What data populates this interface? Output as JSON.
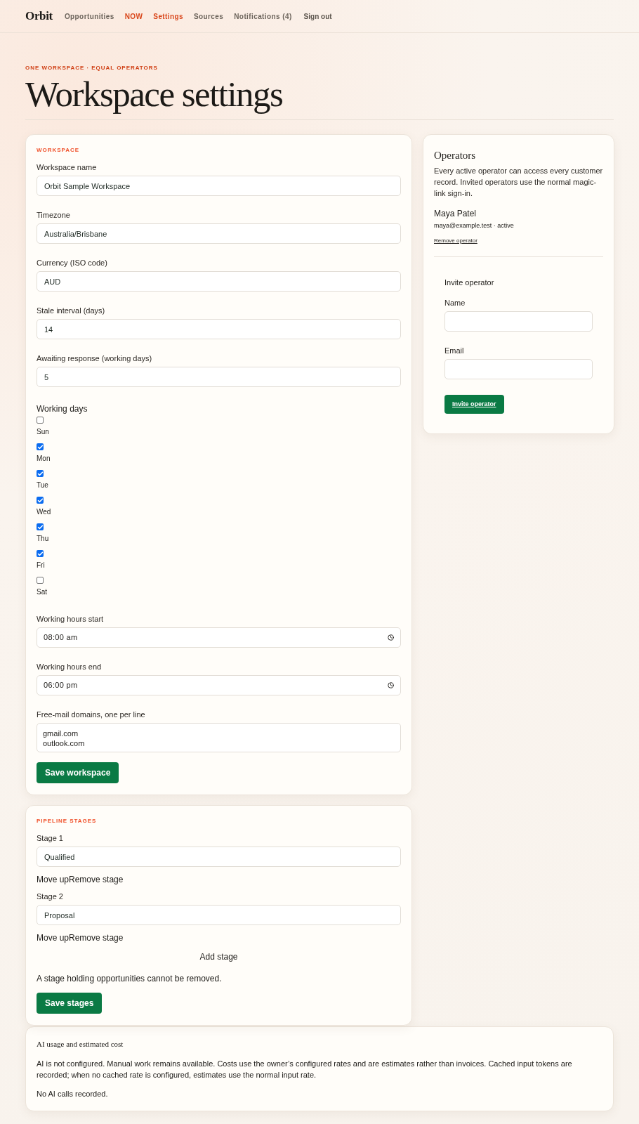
{
  "nav": {
    "logo": "Orbit",
    "items": [
      {
        "label": "Opportunities",
        "accent": false
      },
      {
        "label": "NOW",
        "accent": true
      },
      {
        "label": "Settings",
        "accent": true
      },
      {
        "label": "Sources",
        "accent": false
      },
      {
        "label": "Notifications (4)",
        "accent": false
      }
    ],
    "sign_out": "Sign out"
  },
  "header": {
    "eyebrow": "ONE WORKSPACE · EQUAL OPERATORS",
    "title": "Workspace settings"
  },
  "workspace": {
    "heading": "WORKSPACE",
    "fields": [
      {
        "kind": "text",
        "label": "Workspace name",
        "value": "Orbit Sample Workspace"
      },
      {
        "kind": "text",
        "label": "Timezone",
        "value": "Australia/Brisbane"
      },
      {
        "kind": "text",
        "label": "Currency (ISO code)",
        "value": "AUD"
      },
      {
        "kind": "text",
        "label": "Stale interval (days)",
        "value": "14"
      },
      {
        "kind": "text",
        "label": "Awaiting response (working days)",
        "value": "5"
      }
    ],
    "working_days": {
      "label": "Working days",
      "days": [
        {
          "label": "Sun",
          "checked": false
        },
        {
          "label": "Mon",
          "checked": true
        },
        {
          "label": "Tue",
          "checked": true
        },
        {
          "label": "Wed",
          "checked": true
        },
        {
          "label": "Thu",
          "checked": true
        },
        {
          "label": "Fri",
          "checked": true
        },
        {
          "label": "Sat",
          "checked": false
        }
      ]
    },
    "time_fields": [
      {
        "kind": "time",
        "label": "Working hours start",
        "value": "08:00 am"
      },
      {
        "kind": "time",
        "label": "Working hours end",
        "value": "06:00 pm"
      }
    ],
    "domains": {
      "label": "Free-mail domains, one per line",
      "lines": [
        "gmail.com",
        "outlook.com"
      ]
    },
    "save": "Save workspace"
  },
  "stages": {
    "heading": "PIPELINE STAGES",
    "items": [
      {
        "label": "Stage 1",
        "value": "Qualified",
        "actions": [
          "Move up",
          "Remove stage"
        ]
      },
      {
        "label": "Stage 2",
        "value": "Proposal",
        "actions": [
          "Move up",
          "Remove stage"
        ]
      }
    ],
    "add": "Add stage",
    "note": "A stage holding opportunities cannot be removed.",
    "save": "Save stages"
  },
  "operators": {
    "title": "Operators",
    "description": "Every active operator can access every customer record. Invited operators use the normal magic-link sign-in.",
    "members": [
      {
        "name": "Maya Patel",
        "detail": "maya@example.test · active",
        "remove": "Remove operator"
      }
    ],
    "invite": {
      "title": "Invite operator",
      "fields": [
        {
          "label": "Name"
        },
        {
          "label": "Email"
        }
      ],
      "button": "Invite operator"
    }
  },
  "ai": {
    "title": "AI usage and estimated cost",
    "description": "AI is not configured. Manual work remains available. Costs use the owner’s configured rates and are estimates rather than invoices. Cached input tokens are recorded; when no cached rate is configured, estimates use the normal input rate.",
    "empty": "No AI calls recorded."
  }
}
